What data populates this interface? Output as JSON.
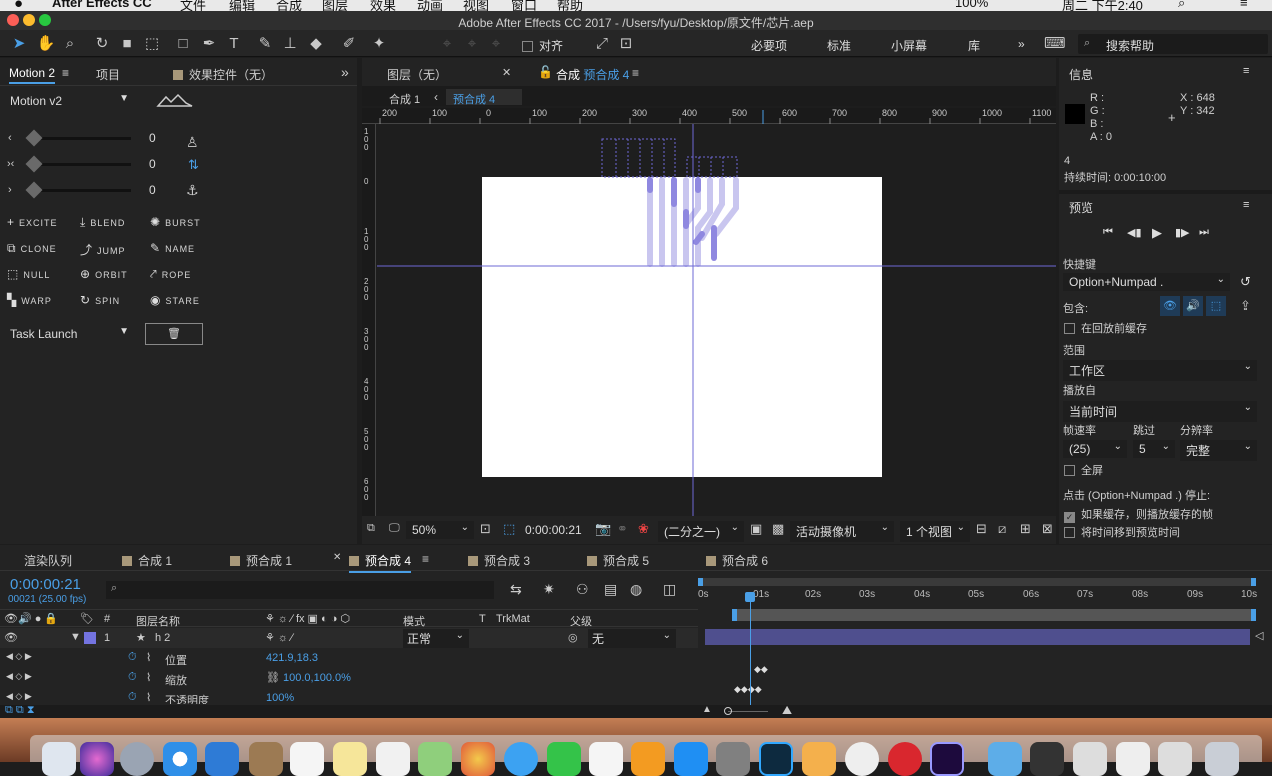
{
  "menubar": {
    "app": "After Effects CC",
    "items": [
      "文件",
      "编辑",
      "合成",
      "图层",
      "效果",
      "动画",
      "视图",
      "窗口",
      "帮助"
    ],
    "battery": "100%",
    "clock": "周二 下午2:40"
  },
  "titlebar": {
    "title": "Adobe After Effects CC 2017 - /Users/fyu/Desktop/原文件/芯片.aep"
  },
  "toolbar": {
    "snap_label": "对齐",
    "workspaces": [
      "必要项",
      "标准",
      "小屏幕",
      "库"
    ],
    "search_placeholder": "搜索帮助"
  },
  "left_panel": {
    "tabs": [
      "Motion 2",
      "项目",
      "效果控件（无）"
    ],
    "preset": "Motion v2",
    "slider_values": [
      "0",
      "0",
      "0"
    ],
    "buttons": [
      [
        "EXCITE",
        "BLEND",
        "BURST"
      ],
      [
        "CLONE",
        "JUMP",
        "NAME"
      ],
      [
        "NULL",
        "ORBIT",
        "ROPE"
      ],
      [
        "WARP",
        "SPIN",
        "STARE"
      ]
    ],
    "task_launch": "Task Launch"
  },
  "viewer": {
    "tabs": [
      "图层（无）",
      "合成 预合成 4"
    ],
    "breadcrumbs": [
      "合成 1",
      "预合成 4"
    ],
    "ruler_h": [
      "200",
      "100",
      "0",
      "100",
      "200",
      "300",
      "400",
      "500",
      "600",
      "700",
      "800",
      "900",
      "1000",
      "1100"
    ],
    "ruler_v": [
      "100",
      "0",
      "100",
      "200",
      "300",
      "400",
      "500",
      "600"
    ],
    "zoom": "50%",
    "timecode": "0:00:00:21",
    "resolution": "(二分之一)",
    "camera": "活动摄像机",
    "views": "1 个视图"
  },
  "info": {
    "title": "信息",
    "r": "R :",
    "g": "G :",
    "b": "B :",
    "a": "A : 0",
    "x": "X : 648",
    "y": "Y : 342",
    "layer": "4",
    "duration": "持续时间: 0:00:10:00"
  },
  "preview": {
    "title": "预览",
    "shortcut_label": "快捷键",
    "shortcut": "Option+Numpad .",
    "include_label": "包含:",
    "cache_label": "在回放前缓存",
    "range_label": "范围",
    "range": "工作区",
    "play_from_label": "播放自",
    "play_from": "当前时间",
    "fps_label": "帧速率",
    "skip_label": "跳过",
    "res_label": "分辨率",
    "fps": "(25)",
    "skip": "5",
    "res": "完整",
    "fullscreen": "全屏",
    "stop_label": "点击 (Option+Numpad .) 停止:",
    "opt1": "如果缓存，则播放缓存的帧",
    "opt2": "将时间移到预览时间"
  },
  "timeline": {
    "tabs": [
      "渲染队列",
      "合成 1",
      "预合成 1",
      "预合成 4",
      "预合成 3",
      "预合成 5",
      "预合成 6"
    ],
    "timecode": "0:00:00:21",
    "frames": "00021 (25.00 fps)",
    "col_headers": {
      "num": "#",
      "name": "图层名称",
      "mode": "模式",
      "t": "T",
      "trkmat": "TrkMat",
      "parent": "父级"
    },
    "layer": {
      "num": "1",
      "name": "h 2",
      "mode": "正常",
      "parent": "无"
    },
    "props": [
      {
        "name": "位置",
        "value": "421.9,18.3"
      },
      {
        "name": "缩放",
        "value": "100.0,100.0%"
      },
      {
        "name": "不透明度",
        "value": "100%"
      }
    ],
    "ticks": [
      "0s",
      "01s",
      "02s",
      "03s",
      "04s",
      "05s",
      "06s",
      "07s",
      "08s",
      "09s",
      "10s"
    ]
  }
}
